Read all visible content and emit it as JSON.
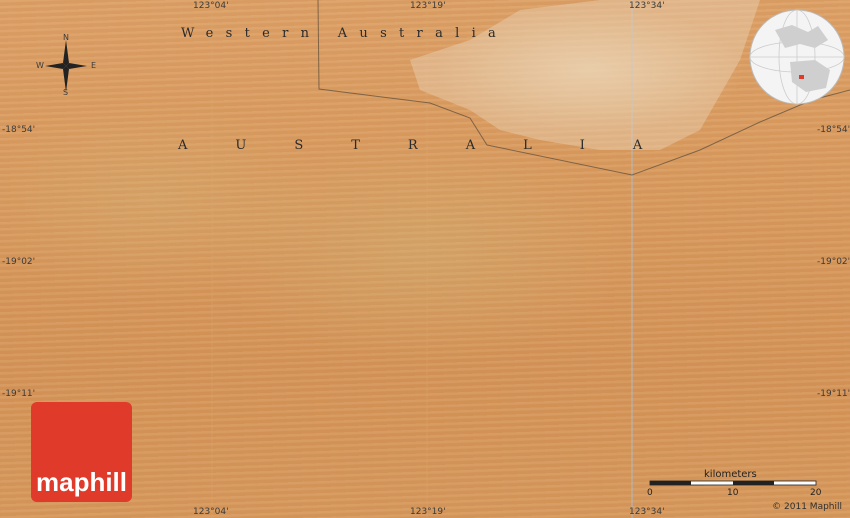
{
  "map": {
    "region_label": "Western Australia",
    "country_label": "AUSTRALIA",
    "logo_text": "maphill",
    "copyright": "© 2011 Maphill",
    "compass": {
      "n": "N",
      "s": "S",
      "e": "E",
      "w": "W"
    },
    "coords": {
      "lon_1": "123°04'",
      "lon_2": "123°19'",
      "lon_3": "123°34'",
      "lat_1": "-18°54'",
      "lat_2": "-19°02'",
      "lat_3": "-19°11'"
    },
    "scale": {
      "title": "kilometers",
      "ticks": [
        "0",
        "10",
        "20"
      ]
    },
    "colors": {
      "logo": "#e03a2a",
      "desert": "#d89a5e"
    }
  }
}
